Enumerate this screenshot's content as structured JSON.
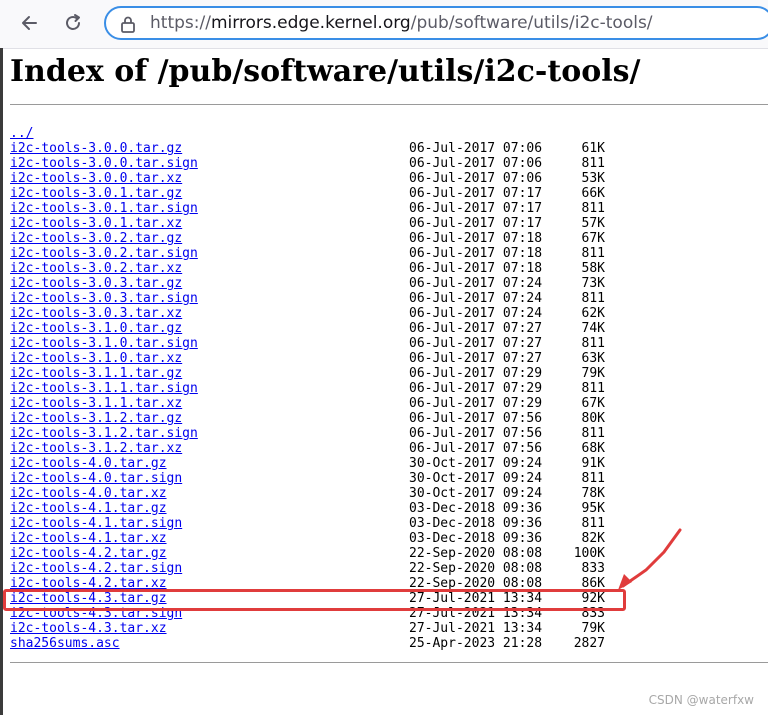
{
  "browser": {
    "url_prefix": "https://",
    "url_host": "mirrors.edge.kernel.org",
    "url_path": "/pub/software/utils/i2c-tools/"
  },
  "page": {
    "title": "Index of /pub/software/utils/i2c-tools/",
    "parent_link": "../"
  },
  "files": [
    {
      "name": "i2c-tools-3.0.0.tar.gz",
      "date": "06-Jul-2017 07:06",
      "size": "61K"
    },
    {
      "name": "i2c-tools-3.0.0.tar.sign",
      "date": "06-Jul-2017 07:06",
      "size": "811"
    },
    {
      "name": "i2c-tools-3.0.0.tar.xz",
      "date": "06-Jul-2017 07:06",
      "size": "53K"
    },
    {
      "name": "i2c-tools-3.0.1.tar.gz",
      "date": "06-Jul-2017 07:17",
      "size": "66K"
    },
    {
      "name": "i2c-tools-3.0.1.tar.sign",
      "date": "06-Jul-2017 07:17",
      "size": "811"
    },
    {
      "name": "i2c-tools-3.0.1.tar.xz",
      "date": "06-Jul-2017 07:17",
      "size": "57K"
    },
    {
      "name": "i2c-tools-3.0.2.tar.gz",
      "date": "06-Jul-2017 07:18",
      "size": "67K"
    },
    {
      "name": "i2c-tools-3.0.2.tar.sign",
      "date": "06-Jul-2017 07:18",
      "size": "811"
    },
    {
      "name": "i2c-tools-3.0.2.tar.xz",
      "date": "06-Jul-2017 07:18",
      "size": "58K"
    },
    {
      "name": "i2c-tools-3.0.3.tar.gz",
      "date": "06-Jul-2017 07:24",
      "size": "73K"
    },
    {
      "name": "i2c-tools-3.0.3.tar.sign",
      "date": "06-Jul-2017 07:24",
      "size": "811"
    },
    {
      "name": "i2c-tools-3.0.3.tar.xz",
      "date": "06-Jul-2017 07:24",
      "size": "62K"
    },
    {
      "name": "i2c-tools-3.1.0.tar.gz",
      "date": "06-Jul-2017 07:27",
      "size": "74K"
    },
    {
      "name": "i2c-tools-3.1.0.tar.sign",
      "date": "06-Jul-2017 07:27",
      "size": "811"
    },
    {
      "name": "i2c-tools-3.1.0.tar.xz",
      "date": "06-Jul-2017 07:27",
      "size": "63K"
    },
    {
      "name": "i2c-tools-3.1.1.tar.gz",
      "date": "06-Jul-2017 07:29",
      "size": "79K"
    },
    {
      "name": "i2c-tools-3.1.1.tar.sign",
      "date": "06-Jul-2017 07:29",
      "size": "811"
    },
    {
      "name": "i2c-tools-3.1.1.tar.xz",
      "date": "06-Jul-2017 07:29",
      "size": "67K"
    },
    {
      "name": "i2c-tools-3.1.2.tar.gz",
      "date": "06-Jul-2017 07:56",
      "size": "80K"
    },
    {
      "name": "i2c-tools-3.1.2.tar.sign",
      "date": "06-Jul-2017 07:56",
      "size": "811"
    },
    {
      "name": "i2c-tools-3.1.2.tar.xz",
      "date": "06-Jul-2017 07:56",
      "size": "68K"
    },
    {
      "name": "i2c-tools-4.0.tar.gz",
      "date": "30-Oct-2017 09:24",
      "size": "91K"
    },
    {
      "name": "i2c-tools-4.0.tar.sign",
      "date": "30-Oct-2017 09:24",
      "size": "811"
    },
    {
      "name": "i2c-tools-4.0.tar.xz",
      "date": "30-Oct-2017 09:24",
      "size": "78K"
    },
    {
      "name": "i2c-tools-4.1.tar.gz",
      "date": "03-Dec-2018 09:36",
      "size": "95K"
    },
    {
      "name": "i2c-tools-4.1.tar.sign",
      "date": "03-Dec-2018 09:36",
      "size": "811"
    },
    {
      "name": "i2c-tools-4.1.tar.xz",
      "date": "03-Dec-2018 09:36",
      "size": "82K"
    },
    {
      "name": "i2c-tools-4.2.tar.gz",
      "date": "22-Sep-2020 08:08",
      "size": "100K"
    },
    {
      "name": "i2c-tools-4.2.tar.sign",
      "date": "22-Sep-2020 08:08",
      "size": "833"
    },
    {
      "name": "i2c-tools-4.2.tar.xz",
      "date": "22-Sep-2020 08:08",
      "size": "86K"
    },
    {
      "name": "i2c-tools-4.3.tar.gz",
      "date": "27-Jul-2021 13:34",
      "size": "92K"
    },
    {
      "name": "i2c-tools-4.3.tar.sign",
      "date": "27-Jul-2021 13:34",
      "size": "833"
    },
    {
      "name": "i2c-tools-4.3.tar.xz",
      "date": "27-Jul-2021 13:34",
      "size": "79K"
    },
    {
      "name": "sha256sums.asc",
      "date": "25-Apr-2023 21:28",
      "size": "2827"
    }
  ],
  "annotation": {
    "highlighted_file": "i2c-tools-4.3.tar.gz",
    "color": "#e03c3c"
  },
  "watermark": "CSDN @waterfxw",
  "colors": {
    "link": "#0000ee",
    "url_focus": "#3a8ee6"
  },
  "icons": {
    "back": "arrow-left-icon",
    "reload": "reload-icon",
    "site": "lock-icon"
  }
}
